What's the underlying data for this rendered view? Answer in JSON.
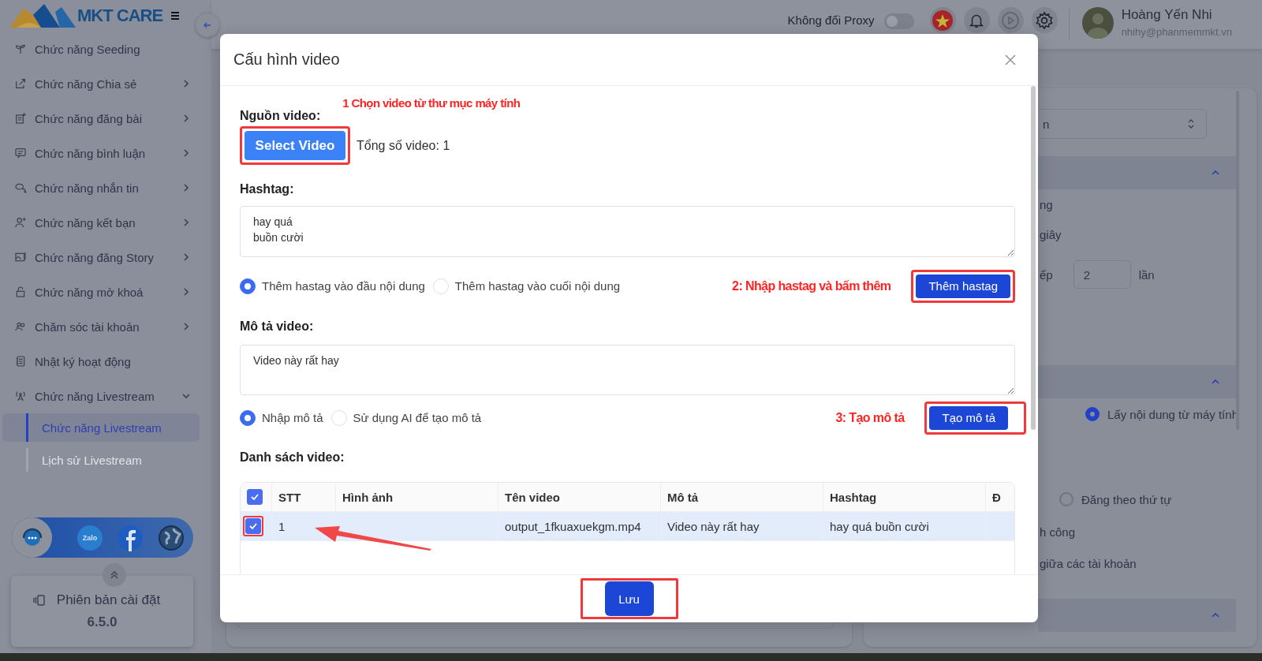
{
  "sidebar": {
    "logo_text": "MKT CARE",
    "items": [
      {
        "label": "Chức năng Seeding",
        "kind": "link"
      },
      {
        "label": "Chức năng Chia sẻ",
        "kind": "group",
        "expanded": false
      },
      {
        "label": "Chức năng đăng bài",
        "kind": "group",
        "expanded": false
      },
      {
        "label": "Chức năng bình luận",
        "kind": "group",
        "expanded": false
      },
      {
        "label": "Chức năng nhắn tin",
        "kind": "group",
        "expanded": false
      },
      {
        "label": "Chức năng kết bạn",
        "kind": "group",
        "expanded": false
      },
      {
        "label": "Chức năng đăng Story",
        "kind": "group",
        "expanded": false
      },
      {
        "label": "Chức năng mở khoá",
        "kind": "group",
        "expanded": false
      },
      {
        "label": "Chăm sóc tài khoản",
        "kind": "group",
        "expanded": false
      },
      {
        "label": "Nhật ký hoạt động",
        "kind": "link"
      },
      {
        "label": "Chức năng Livestream",
        "kind": "group",
        "expanded": true,
        "children": [
          {
            "label": "Chức năng Livestream",
            "selected": true
          },
          {
            "label": "Lịch sử Livestream",
            "selected": false
          }
        ]
      }
    ],
    "social": {
      "zalo_label": "Zalo"
    },
    "version": {
      "label": "Phiên bản cài đặt",
      "number": "6.5.0"
    }
  },
  "topbar": {
    "proxy_label": "Không đổi Proxy",
    "proxy_on": false,
    "user_name": "Hoàng Yến Nhi",
    "user_email": "nhihy@phanmemmkt.vn"
  },
  "background_panel": {
    "select_value": "n",
    "sections": [
      {
        "expanded": true
      },
      {
        "expanded": true
      },
      {
        "expanded": true
      }
    ],
    "fragments": [
      "ng",
      "giây"
    ],
    "repeat_row": {
      "label": "ếp",
      "value": "2",
      "unit": "lần"
    },
    "radios": [
      {
        "label": "Lấy nội dung từ máy tính",
        "selected": true
      },
      {
        "label": "Đăng theo thứ tự",
        "selected": false
      }
    ],
    "notes": [
      "h công",
      "giữa các tài khoản"
    ]
  },
  "modal": {
    "title": "Cấu hình video",
    "source_label": "Nguồn video:",
    "select_button": "Select Video",
    "total_text": "Tổng số video: 1",
    "hashtag_label": "Hashtag:",
    "hashtag_value": "hay quá\nbuồn cười",
    "hashtag_positions": [
      {
        "label": "Thêm hastag vào đầu nội dung",
        "selected": true
      },
      {
        "label": "Thêm hastag vào cuối nội dung",
        "selected": false
      }
    ],
    "add_hashtag_button": "Thêm hastag",
    "description_label": "Mô tả video:",
    "description_value": "Video này rất hay",
    "description_modes": [
      {
        "label": "Nhập mô tả",
        "selected": true
      },
      {
        "label": "Sử dụng AI để tạo mô tả",
        "selected": false
      }
    ],
    "generate_button": "Tạo mô tả",
    "list_label": "Danh sách video:",
    "table": {
      "all_checked": true,
      "columns": [
        "STT",
        "Hình ảnh",
        "Tên video",
        "Mô tả",
        "Hashtag",
        "Đ"
      ],
      "rows": [
        {
          "checked": true,
          "stt": "1",
          "file_name": "output_1fkuaxuekgm.mp4",
          "description": "Video này rất hay",
          "hashtag": "hay quá buồn cười"
        }
      ]
    },
    "save_button": "Lưu",
    "annotations": [
      {
        "text": "1 Chọn video từ thư mục máy tính"
      },
      {
        "text": "2: Nhập hastag và bấm thêm"
      },
      {
        "text": "3: Tạo mô tả"
      }
    ]
  }
}
